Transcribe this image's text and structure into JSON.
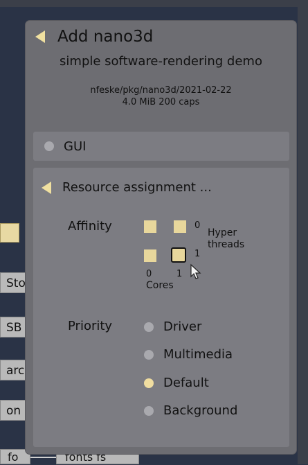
{
  "background": {
    "left_tabs": [
      "Sto",
      "SB",
      "arc",
      "on"
    ],
    "bottom_left_label": "fo",
    "bottom_tab_label": "fonts fs"
  },
  "dialog": {
    "title": "Add nano3d",
    "subtitle": "simple software-rendering demo",
    "meta_path": "nfeske/pkg/nano3d/2021-02-22",
    "meta_size": "4.0 MiB 200 caps",
    "gui_section_label": "GUI",
    "resource_section_label": "Resource assignment ...",
    "affinity": {
      "label": "Affinity",
      "row_labels": [
        "0",
        "1"
      ],
      "hyper_label": "Hyper",
      "threads_label": "threads",
      "col_labels": [
        "0",
        "1"
      ],
      "cores_label": "Cores",
      "selected": "1,1"
    },
    "priority": {
      "label": "Priority",
      "options": [
        "Driver",
        "Multimedia",
        "Default",
        "Background"
      ],
      "selected": "Default"
    }
  },
  "colors": {
    "accent": "#f0dda0",
    "dialog_bg": "#6d6d72",
    "section_bg": "#7c7c82",
    "page_bg": "#2a3346"
  }
}
